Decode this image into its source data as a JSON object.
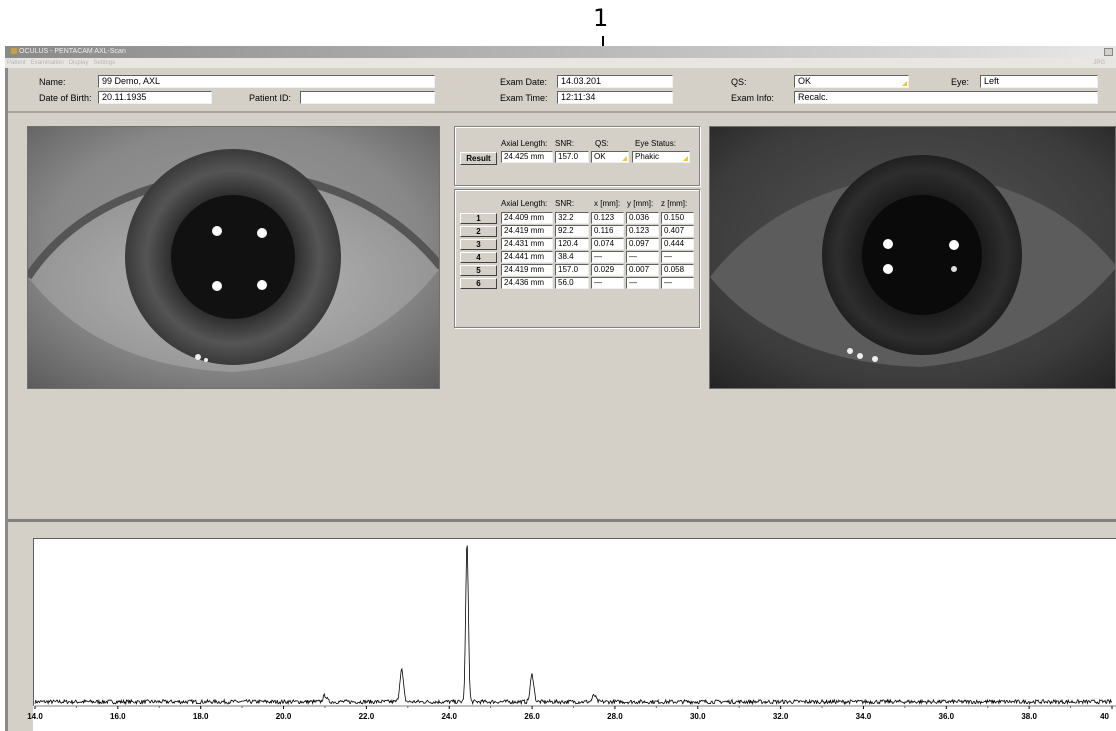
{
  "callout": {
    "number": "1"
  },
  "window": {
    "title": "OCULUS - PENTACAM  AXL-Scan",
    "menu": [
      "Patient",
      "Examination",
      "Display",
      "Settings"
    ],
    "menu_right": "JPG"
  },
  "patient": {
    "name_label": "Name:",
    "name": "99 Demo, AXL",
    "dob_label": "Date of Birth:",
    "dob": "20.11.1935",
    "patient_id_label": "Patient ID:",
    "patient_id": ""
  },
  "exam": {
    "date_label": "Exam Date:",
    "date": "14.03.201",
    "time_label": "Exam Time:",
    "time": "12:11:34",
    "qs_label": "QS:",
    "qs": "OK",
    "info_label": "Exam Info:",
    "info": "Recalc.",
    "eye_label": "Eye:",
    "eye": "Left"
  },
  "result": {
    "button": "Result",
    "headers": {
      "axial": "Axial Length:",
      "snr": "SNR:",
      "qs": "QS:",
      "status": "Eye Status:"
    },
    "axial": "24.425 mm",
    "snr": "157.0",
    "qs": "OK",
    "status": "Phakic"
  },
  "measurements": {
    "headers": {
      "axial": "Axial Length:",
      "snr": "SNR:",
      "x": "x [mm]:",
      "y": "y [mm]:",
      "z": "z [mm]:"
    },
    "rows": [
      {
        "btn": "1",
        "axial": "24.409 mm",
        "snr": "32.2",
        "x": "0.123",
        "y": "0.036",
        "z": "0.150"
      },
      {
        "btn": "2",
        "axial": "24.419 mm",
        "snr": "92.2",
        "x": "0.116",
        "y": "0.123",
        "z": "0.407"
      },
      {
        "btn": "3",
        "axial": "24.431 mm",
        "snr": "120.4",
        "x": "0.074",
        "y": "0.097",
        "z": "0.444"
      },
      {
        "btn": "4",
        "axial": "24.441 mm",
        "snr": "38.4",
        "x": "—",
        "y": "—",
        "z": "—"
      },
      {
        "btn": "5",
        "axial": "24.419 mm",
        "snr": "157.0",
        "x": "0.029",
        "y": "0.007",
        "z": "0.058"
      },
      {
        "btn": "6",
        "axial": "24.436 mm",
        "snr": "56.0",
        "x": "—",
        "y": "—",
        "z": "—"
      }
    ]
  },
  "chart_data": {
    "type": "line",
    "x_ticks": [
      "14.0",
      "16.0",
      "18.0",
      "20.0",
      "22.0",
      "24.0",
      "26.0",
      "28.0",
      "30.0",
      "32.0",
      "34.0",
      "36.0",
      "38.0",
      "40"
    ],
    "xlim": [
      14.0,
      40.0
    ],
    "ylim": [
      0,
      1
    ],
    "peaks": [
      {
        "x": 22.85,
        "y": 0.2
      },
      {
        "x": 24.43,
        "y": 1.0
      },
      {
        "x": 26.0,
        "y": 0.17
      },
      {
        "x": 21.0,
        "y": 0.04
      },
      {
        "x": 27.5,
        "y": 0.04
      }
    ],
    "baseline": 0.02,
    "grid": false,
    "line_color": "#000000"
  }
}
